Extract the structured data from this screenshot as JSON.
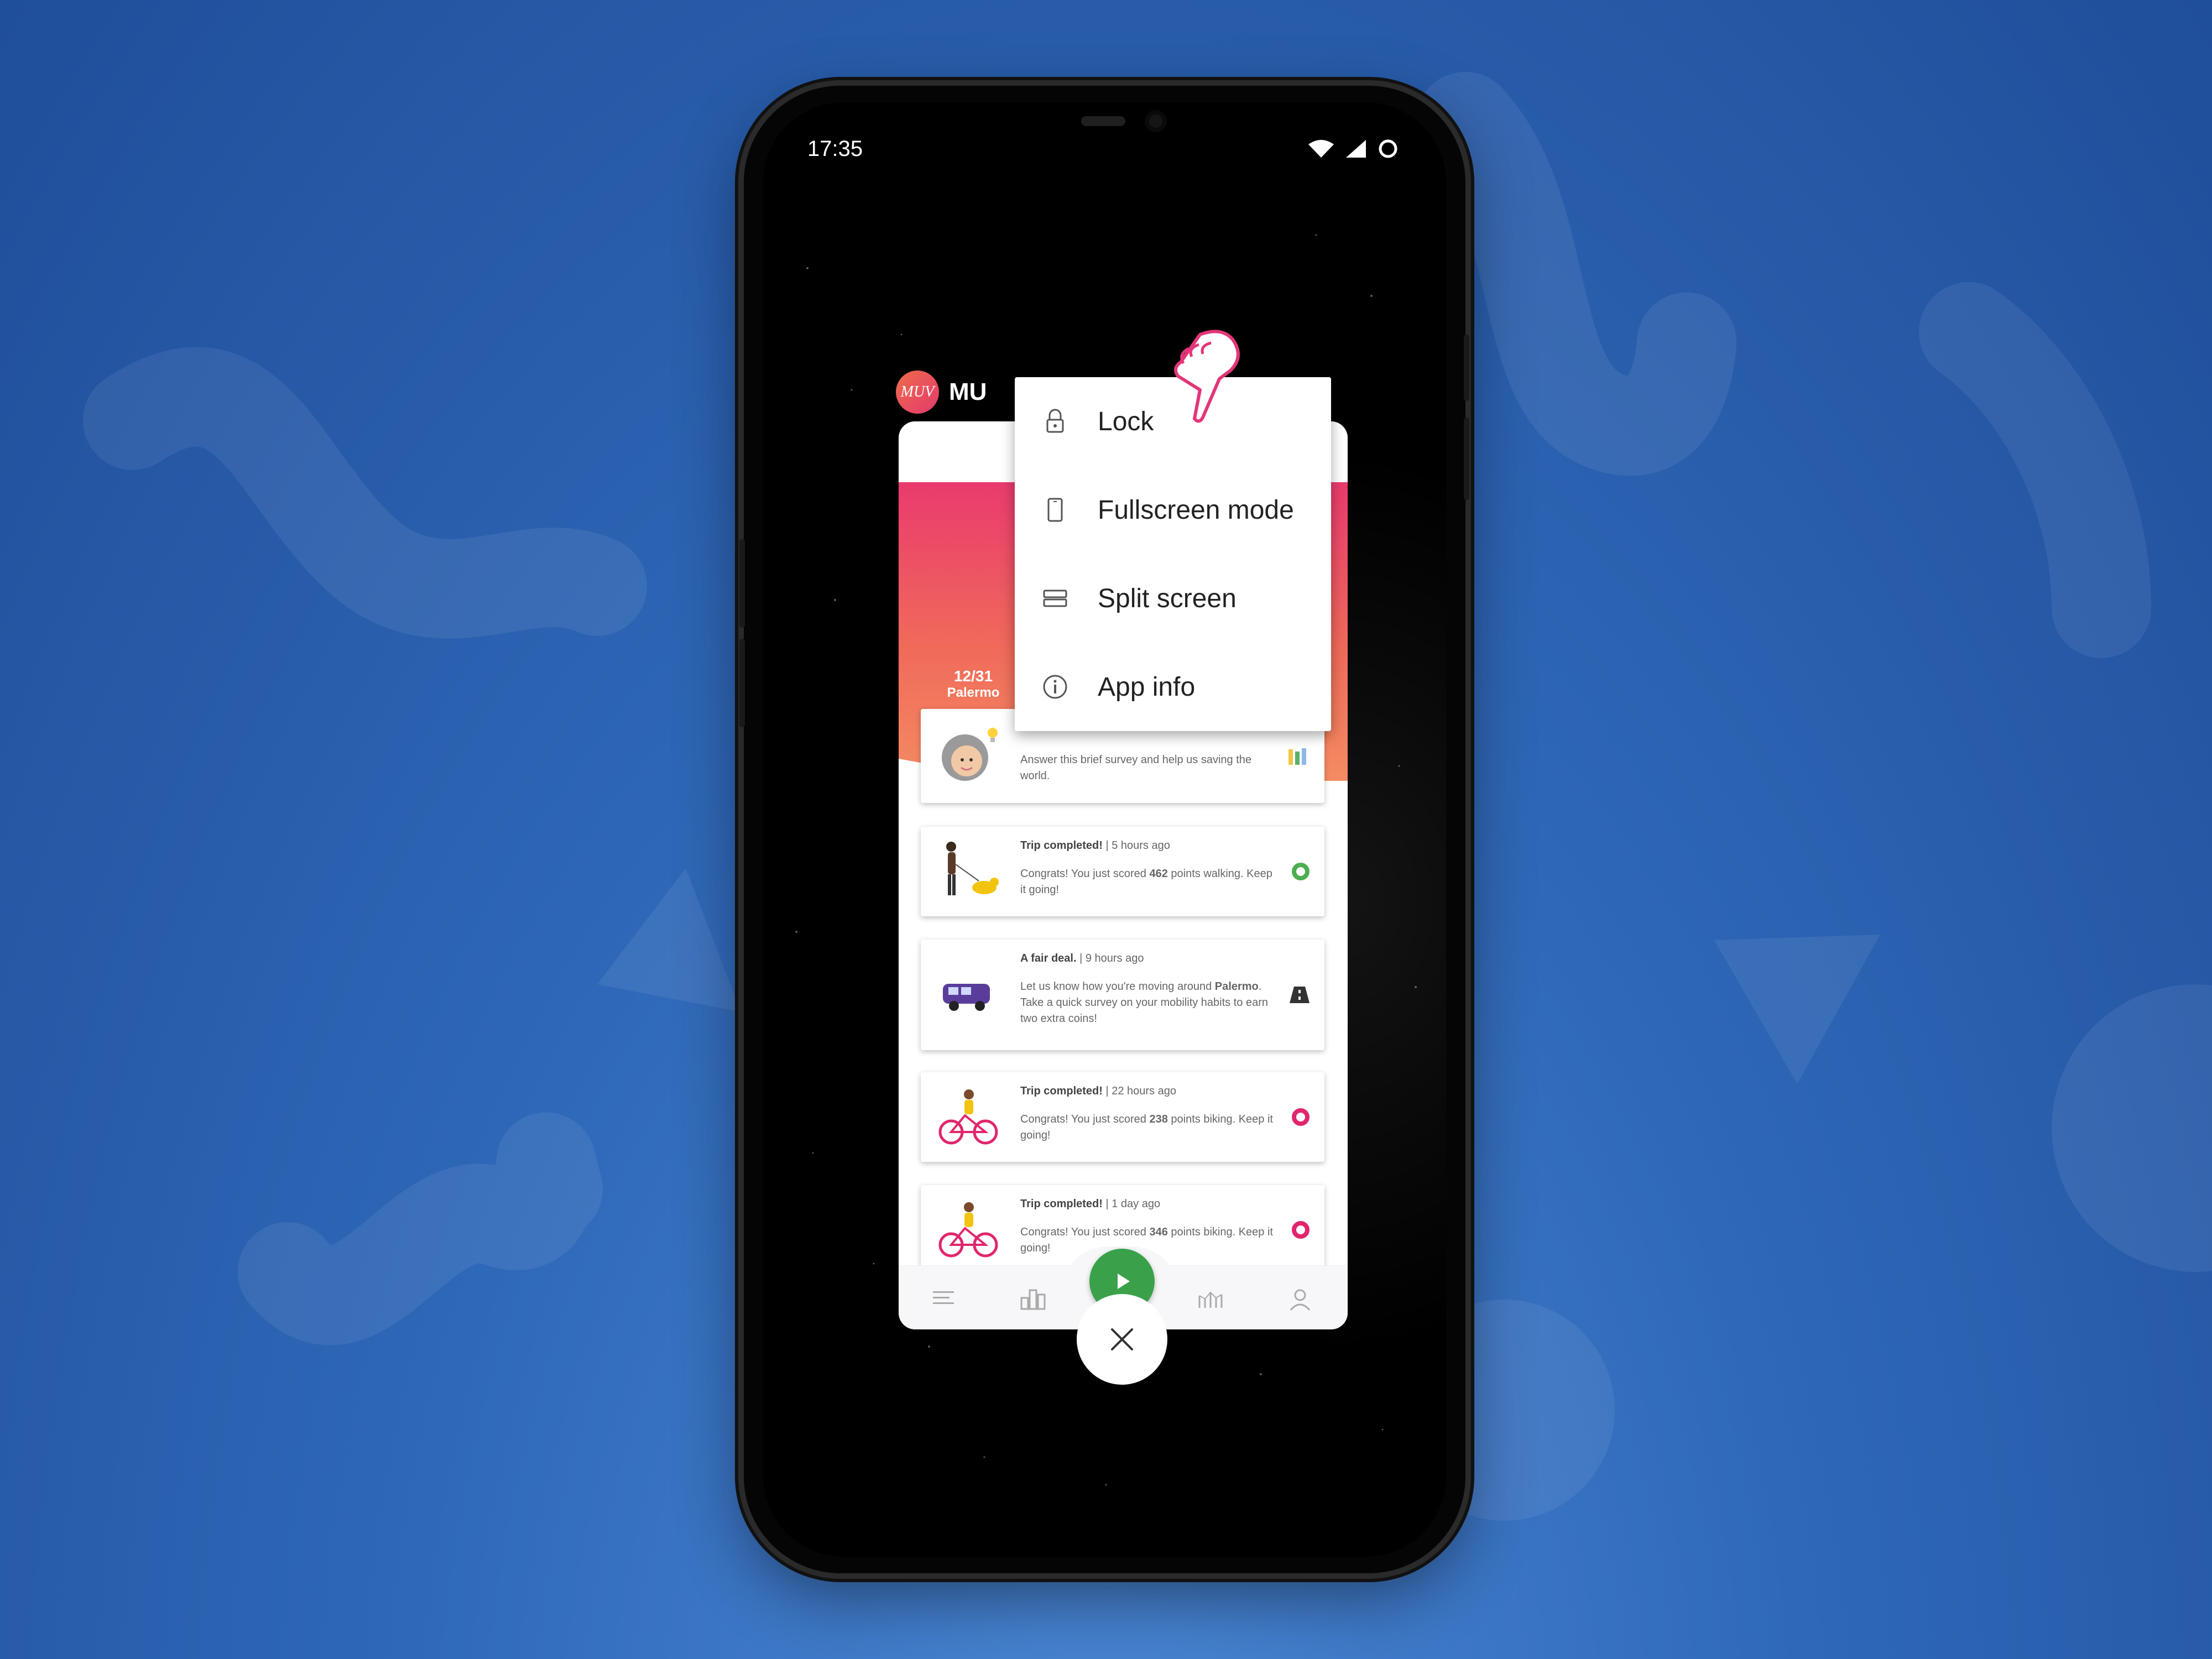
{
  "status_bar": {
    "time": "17:35",
    "icons": [
      "wifi-icon",
      "signal-icon",
      "battery-icon"
    ]
  },
  "app": {
    "logo_text": "MUV",
    "title": "MU",
    "hero": {
      "date": "12/31",
      "city": "Palermo"
    },
    "feed": [
      {
        "illustration": "grandma-lightbulb",
        "title": "",
        "time": "",
        "message": "Answer this brief survey and help us saving the world.",
        "status_icon": "bar-chart-icon"
      },
      {
        "illustration": "person-walking-dog",
        "title": "Trip completed!",
        "time": "5 hours ago",
        "message_pre": "Congrats! You just scored ",
        "points": "462",
        "message_post": " points walking. Keep it going!",
        "status_icon": "ring-green-icon"
      },
      {
        "illustration": "purple-van",
        "title": "A fair deal.",
        "time": "9 hours ago",
        "message_pre": "Let us know how you're moving around ",
        "city": "Palermo",
        "message_post": ". Take a quick survey on your mobility habits to earn two extra coins!",
        "status_icon": "road-icon"
      },
      {
        "illustration": "cyclist",
        "title": "Trip completed!",
        "time": "22 hours ago",
        "message_pre": "Congrats! You just scored ",
        "points": "238",
        "message_post": " points biking. Keep it going!",
        "status_icon": "ring-pink-icon"
      },
      {
        "illustration": "cyclist",
        "title": "Trip completed!",
        "time": "1 day ago",
        "message_pre": "Congrats! You just scored ",
        "points": "346",
        "message_post": " points biking. Keep it going!",
        "status_icon": "ring-pink-icon"
      }
    ],
    "nav": [
      "menu-icon",
      "leaderboard-icon",
      "play-icon",
      "stats-icon",
      "profile-icon"
    ]
  },
  "context_menu": {
    "items": [
      {
        "label": "Lock",
        "icon": "lock-icon"
      },
      {
        "label": "Fullscreen mode",
        "icon": "phone-icon"
      },
      {
        "label": "Split screen",
        "icon": "split-screen-icon"
      },
      {
        "label": "App info",
        "icon": "info-icon"
      }
    ]
  },
  "colors": {
    "background": "#2f68b8",
    "brand_gradient_start": "#ea3a6e",
    "brand_gradient_end": "#f48b62",
    "play_green": "#3aa14a",
    "walk_green": "#4caf50",
    "bike_pink": "#e0266d",
    "hand_pink": "#e3357a"
  }
}
